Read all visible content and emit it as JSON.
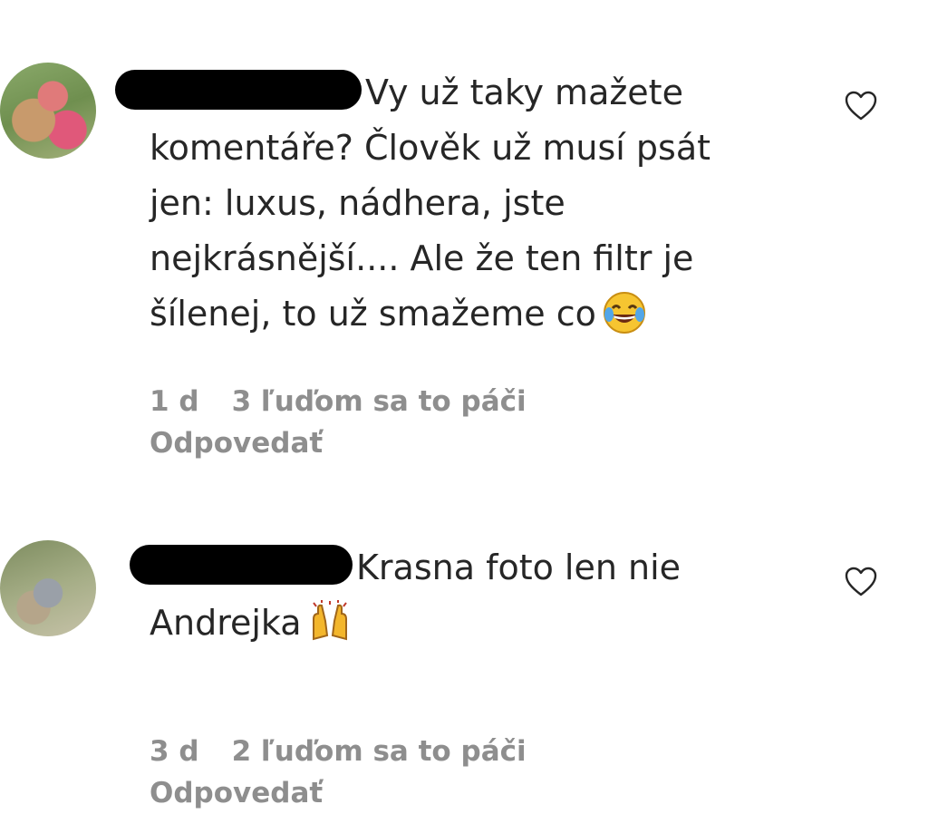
{
  "comments": [
    {
      "text_lines": [
        "Vy už taky mažete",
        "komentáře? Člověk už musí psát",
        "jen: luxus, nádhera, jste",
        "nejkrásnější.... Ale že ten filtr je",
        "šílenej, to už smažeme co"
      ],
      "emoji": "face-with-tears-of-joy",
      "time": "1 d",
      "likes": "3 ľuďom sa to páči",
      "reply_label": "Odpovedať"
    },
    {
      "text_lines": [
        "Krasna foto len nie",
        "Andrejka"
      ],
      "emoji": "raising-hands",
      "time": "3 d",
      "likes": "2 ľuďom sa to páči",
      "reply_label": "Odpovedať"
    }
  ],
  "icons": {
    "like": "heart-outline-icon"
  },
  "colors": {
    "text": "#262626",
    "meta": "#8e8e8e",
    "redaction": "#000000"
  }
}
